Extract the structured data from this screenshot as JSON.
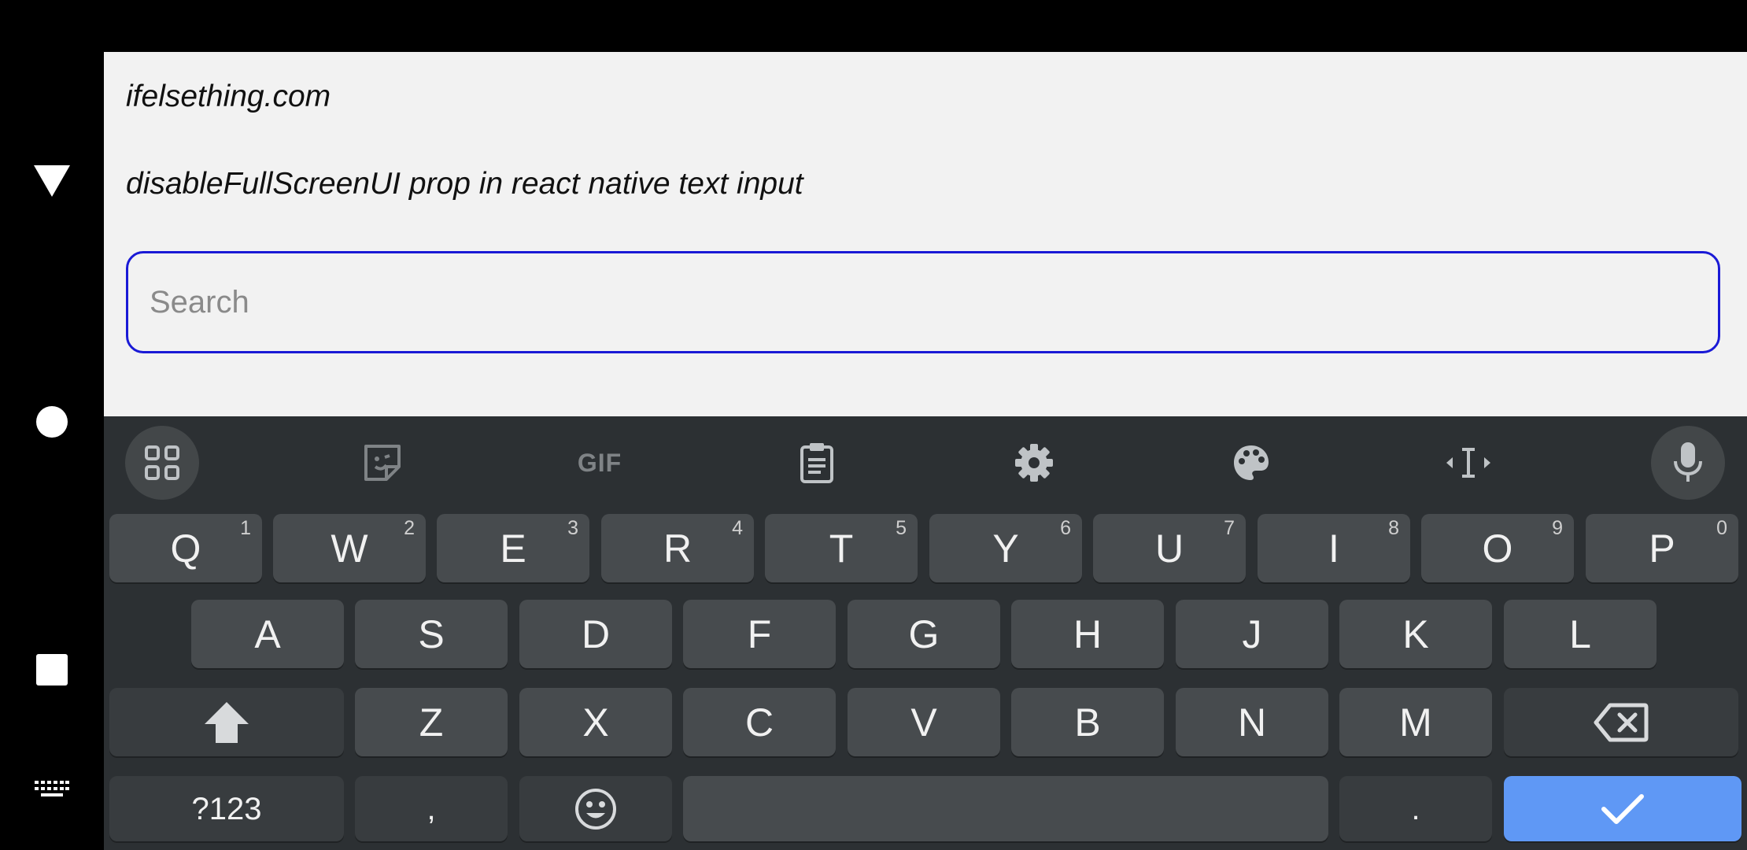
{
  "app": {
    "line1": "ifelsething.com",
    "line2": "disableFullScreenUI prop in react native text input",
    "search": {
      "placeholder": "Search",
      "value": ""
    }
  },
  "navbar": {
    "back_icon": "triangle-down-icon",
    "home_icon": "circle-icon",
    "recents_icon": "square-icon",
    "keyboard_switch_icon": "keyboard-icon"
  },
  "keyboard": {
    "toolbar": [
      {
        "name": "apps-grid-icon"
      },
      {
        "name": "sticker-icon"
      },
      {
        "name": "gif-icon",
        "label": "GIF"
      },
      {
        "name": "clipboard-icon"
      },
      {
        "name": "settings-gear-icon"
      },
      {
        "name": "theme-palette-icon"
      },
      {
        "name": "text-cursor-icon"
      },
      {
        "name": "microphone-icon"
      }
    ],
    "row1": [
      {
        "l": "Q",
        "n": "1"
      },
      {
        "l": "W",
        "n": "2"
      },
      {
        "l": "E",
        "n": "3"
      },
      {
        "l": "R",
        "n": "4"
      },
      {
        "l": "T",
        "n": "5"
      },
      {
        "l": "Y",
        "n": "6"
      },
      {
        "l": "U",
        "n": "7"
      },
      {
        "l": "I",
        "n": "8"
      },
      {
        "l": "O",
        "n": "9"
      },
      {
        "l": "P",
        "n": "0"
      }
    ],
    "row2": [
      "A",
      "S",
      "D",
      "F",
      "G",
      "H",
      "J",
      "K",
      "L"
    ],
    "row3": [
      "Z",
      "X",
      "C",
      "V",
      "B",
      "N",
      "M"
    ],
    "bottom": {
      "symbols": "?123",
      "comma": ",",
      "period": "."
    },
    "colors": {
      "background": "#2c3033",
      "key": "#474b4e",
      "enter": "#5f98f5"
    }
  }
}
